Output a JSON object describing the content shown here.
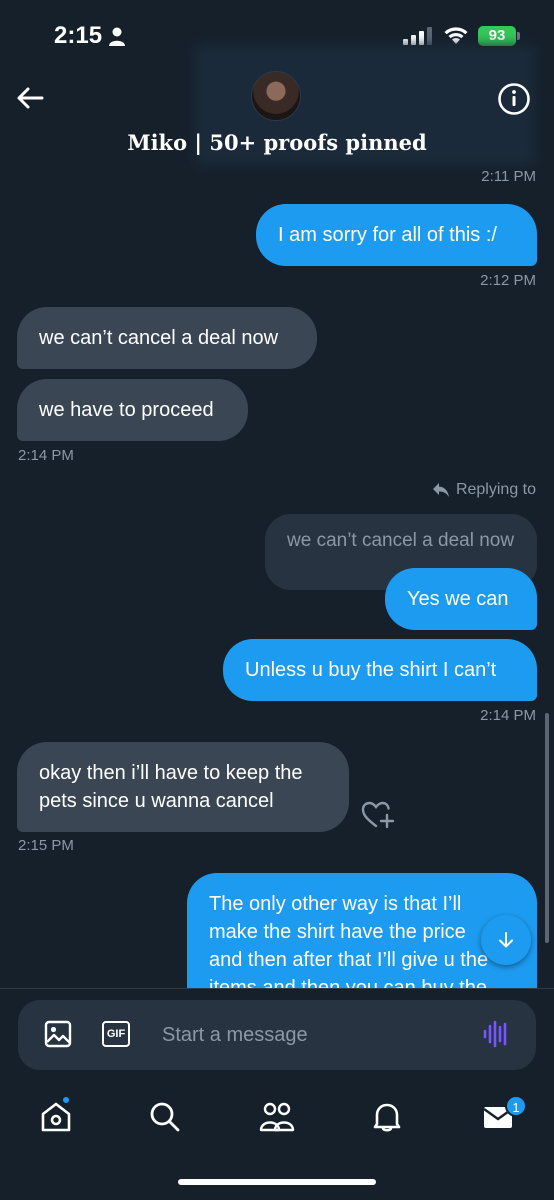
{
  "status": {
    "time": "2:15",
    "battery": "93"
  },
  "header": {
    "title": "Miko | 50+ proofs pinned"
  },
  "messages": {
    "ts1": "2:11 PM",
    "m1": "I am sorry for all of this :/",
    "ts2": "2:12 PM",
    "m2": "we can’t cancel a deal now",
    "m3": "we have to proceed",
    "ts3": "2:14 PM",
    "reply_label": "Replying to",
    "quoted": "we can’t cancel a deal now",
    "m4": "Yes we can",
    "m5": "Unless u buy the shirt I can’t",
    "ts4": "2:14 PM",
    "m6_line1": "okay then i’ll have to keep the",
    "m6_line2": "pets since u wanna cancel",
    "ts5": "2:15 PM",
    "m7_line1": "The only other way is that I’ll",
    "m7_line2": "make the shirt have the price",
    "m7_line3": "and then after that I’ll give u the",
    "m7_line4": "items and then you can buy the"
  },
  "compose": {
    "placeholder": "Start a message",
    "gif_label": "GIF"
  },
  "tabbar": {
    "messages_badge": "1"
  },
  "colors": {
    "background": "#15202b",
    "accent": "#1d9bf0",
    "incoming": "#3a4654"
  }
}
